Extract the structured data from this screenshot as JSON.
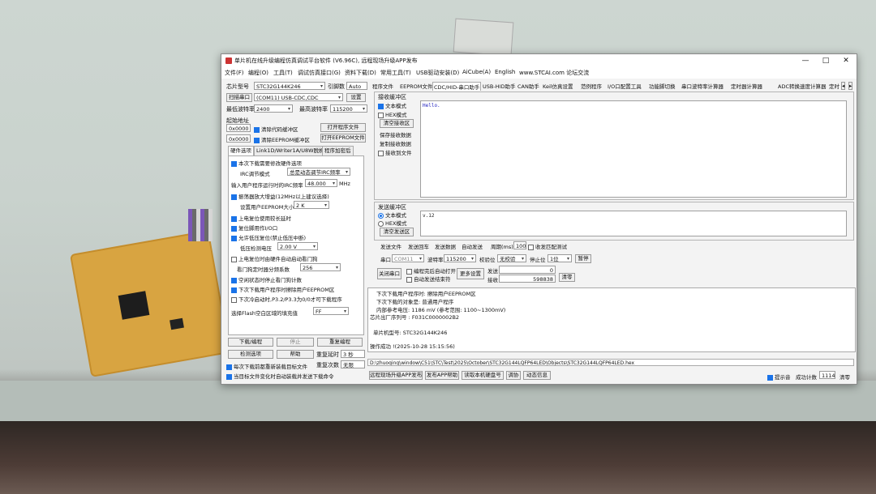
{
  "window": {
    "title": "单片机在线升级编程仿真调试平台软件 (V6.96C), 远程现场升级APP发布",
    "controls": {
      "min": "—",
      "max": "□",
      "close": "✕"
    }
  },
  "menu": [
    "文件(F)",
    "编程(O)",
    "工具(T)",
    "调试仿真接口(G)",
    "资料下载(D)",
    "常用工具(T)",
    "USB驱动安装(D)",
    "AiCube(A)",
    "English",
    "www.STCAI.com 论坛交流"
  ],
  "left": {
    "chip_label": "芯片型号",
    "chip_value": "STC32G144K246",
    "pins_label": "引脚数",
    "pins_value": "Auto",
    "scan_label": "扫描串口",
    "port_value": "(COM11) USB-CDC,CDC",
    "settings_btn": "设置",
    "min_baud_label": "最低波特率",
    "min_baud": "2400",
    "max_baud_label": "最高波特率",
    "max_baud": "115200",
    "start_addr_label": "起始地址",
    "addr1": "0x0000",
    "clear_code": "清除代码缓冲区",
    "open_prog": "打开程序文件",
    "addr2": "0x0000",
    "clear_eeprom": "清除EEPROM缓冲区",
    "open_eeprom": "打开EEPROM文件",
    "tabs": [
      "硬件选项",
      "Link1D/Writer1A/U8W脱机",
      "程序加密后"
    ],
    "options": [
      {
        "text": "本次下载需要修改硬件选项",
        "checked": true
      },
      {
        "text": "IRC调节模式",
        "select": "总是动态调节IRC频率"
      },
      {
        "text": "输入用户程序运行时的IRC频率",
        "select": "48.000",
        "unit": "MHz"
      },
      {
        "text": "振荡器放大增益(12MHz以上建议选择)",
        "checked": true
      },
      {
        "text": "设置用户EEPROM大小",
        "select": "2 K"
      },
      {
        "text": "上电复位使用较长延时",
        "checked": true
      },
      {
        "text": "复位脚用作I/O口",
        "checked": true
      },
      {
        "text": "允许低压复位(禁止低压中断)",
        "checked": true
      },
      {
        "text": "低压检测电压",
        "select": "2.00 V"
      },
      {
        "text": "上电复位时由硬件自动启动看门狗",
        "checked": false
      },
      {
        "text": "看门狗定时器分频系数",
        "select": "256"
      },
      {
        "text": "空闲状态时停止看门狗计数",
        "checked": true
      },
      {
        "text": "下次下载用户程序时擦除用户EEPROM区",
        "checked": true
      },
      {
        "text": "下次冷启动时,P3.2/P3.3为0/0才可下载程序",
        "checked": false
      },
      {
        "text": "选择Flash空白区域的填充值",
        "select": "FF"
      }
    ],
    "download_btn": "下载/编程",
    "stop_btn": "停止",
    "reprogram_btn": "重复编程",
    "detect_btn": "检测选项",
    "help_btn": "帮助",
    "delay_label": "重复延时",
    "delay_value": "3 秒",
    "repeat_label": "重复次数",
    "repeat_value": "无限",
    "auto_reload": "每次下载前都重新装载目标文件",
    "auto_send": "当目标文件变化时自动装载并发送下载命令"
  },
  "right": {
    "tabs": [
      "程序文件",
      "EEPROM文件",
      "CDC/HID-串口助手",
      "USB-HID助手",
      "CAN助手",
      "Keil仿真设置",
      "范例程序",
      "I/O口配置工具",
      "功能脚切换",
      "串口波特率计算器",
      "定时器计算器",
      "ADC转换速度计算器",
      "定时"
    ],
    "recv_group": "接收缓冲区",
    "recv_text_mode": "文本模式",
    "recv_hex_mode": "HEX模式",
    "clear_recv": "清空接收区",
    "save_recv": "保存接收数据",
    "copy_recv": "复制接收数据",
    "recv_to_file": "接收到文件",
    "recv_content": "Hello.",
    "send_group": "发送缓冲区",
    "send_text_mode": "文本模式",
    "send_hex_mode": "HEX模式",
    "clear_send": "清空发送区",
    "send_content": "v.12",
    "send_row": [
      "发送文件",
      "发送回车",
      "发送数据",
      "自动发送"
    ],
    "period_label": "周期(ms)",
    "period_value": "100",
    "close_test": "收发匹配测试",
    "port_label": "串口",
    "port_value": "COM11",
    "baud_label": "波特率",
    "baud_value": "115200",
    "parity_label": "校验位",
    "parity_value": "无校验",
    "stop_label": "停止位",
    "stop_value": "1位",
    "pause_btn": "暂停",
    "close_port": "关闭串口",
    "auto_open": "编程完后自动打开",
    "auto_send_cr": "自动发送结束符",
    "more_settings": "更多设置",
    "sent_label": "发送",
    "sent_value": "0",
    "recv_label": "接收",
    "recv_value": "598838",
    "clear_count": "清零"
  },
  "log": [
    "下次下载用户程序时: 擦除用户EEPROM区",
    "下次下载的对象是: 普通用户程序",
    "内部参考电压: 1186 mV (参考范围: 1100~1300mV)",
    "芯片出厂序列号 : F031C0000002B2",
    "",
    "单片机型号: STC32G144K246",
    "",
    "操作成功 !(2025-10-28 15:15:56)"
  ],
  "path": "D:\\zhuoqing\\window\\C51\\STC\\Test\\2025\\October\\STC32G144LQFP64LED\\Objects\\STC32G144LQFP64LED.hex",
  "status": {
    "buttons": [
      "远程现场升级APP发布",
      "发布APP帮助",
      "读取本机硬盘号",
      "调协",
      "动态信息"
    ],
    "hint": "提示音",
    "count_label": "成功计数",
    "count_value": "1114",
    "clear": "清零"
  }
}
